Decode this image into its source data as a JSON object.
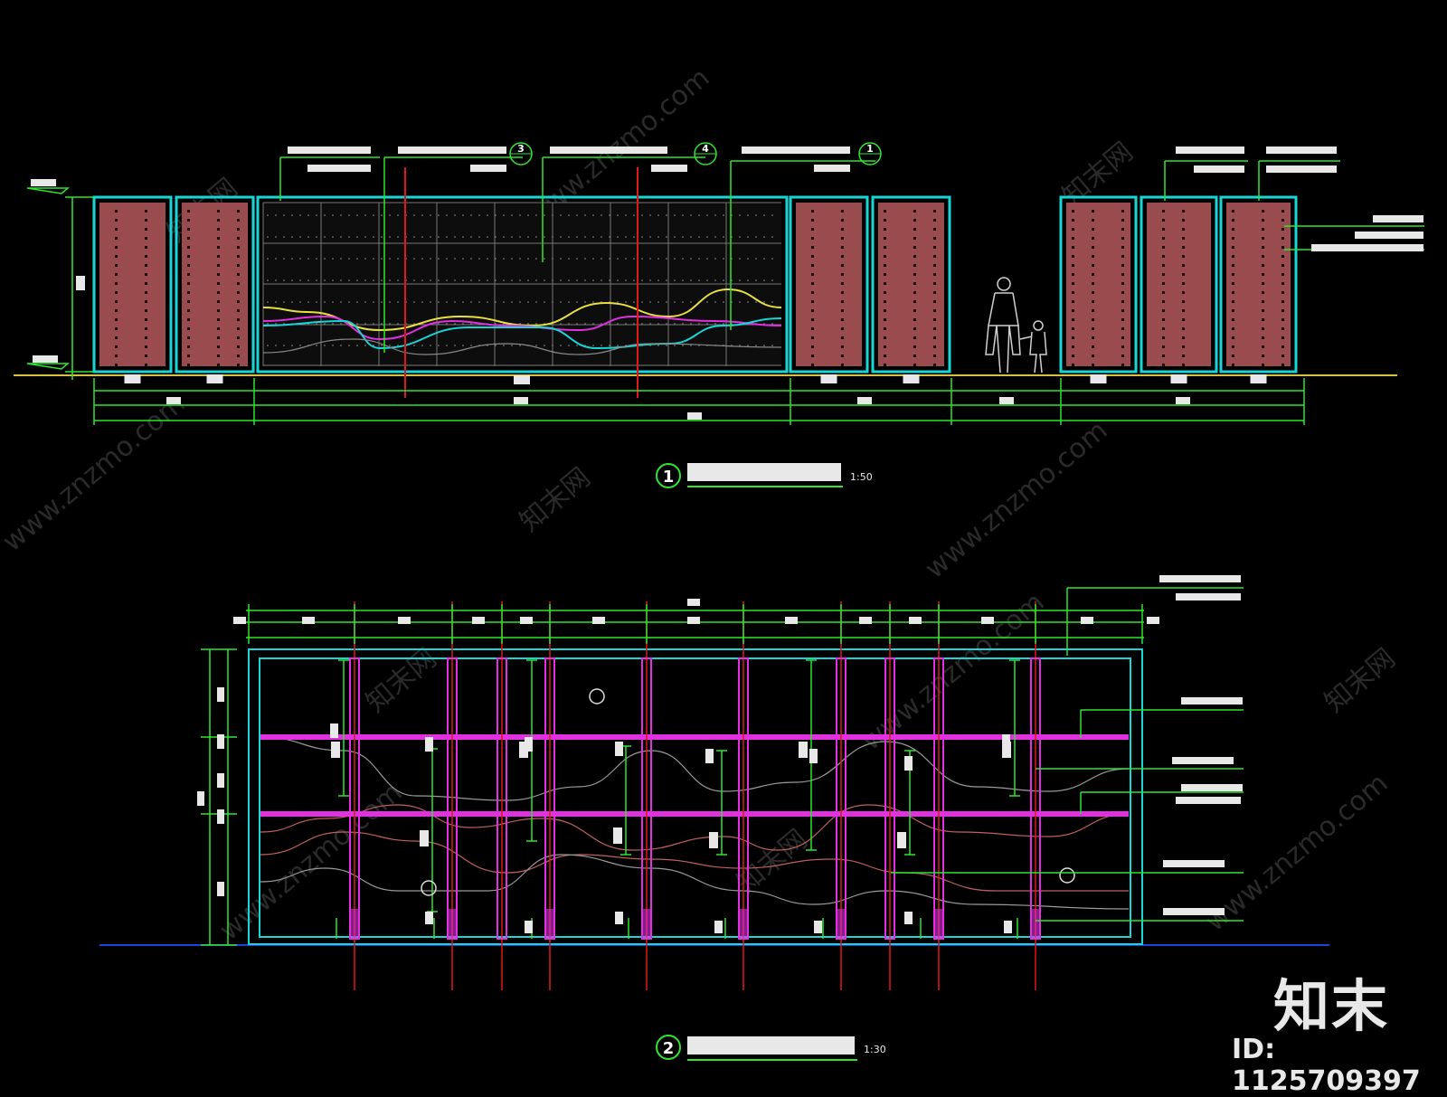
{
  "watermark": {
    "site": "www.znzmo.com",
    "cn": "知末网",
    "brand": "知末",
    "id_label": "ID: 1125709397"
  },
  "drawing_1": {
    "number": "1",
    "scale_text": "1:50"
  },
  "drawing_2": {
    "number": "2",
    "scale_text": "1:30"
  },
  "callouts": {
    "detail_3": "3",
    "detail_4": "4",
    "detail_1": "1"
  },
  "colors": {
    "cyan": "#18d6d6",
    "green": "#2ee62e",
    "red": "#e01818",
    "magenta": "#e030e0",
    "yellow": "#e8e040",
    "panel": "#9a4b4e",
    "blue": "#2040e0",
    "grey": "#9a9a9a"
  }
}
